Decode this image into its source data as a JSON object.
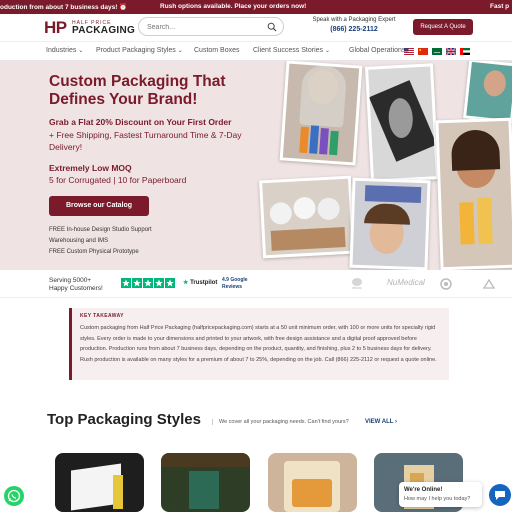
{
  "topbar": {
    "left_text": "oduction from about 7 business days! ⏰",
    "center_text": "Rush options available. Place your orders now!",
    "right_text": "Fast p"
  },
  "header": {
    "logo_mark": "HP",
    "logo_top": "HALF PRICE",
    "logo_bottom": "PACKAGING",
    "search_placeholder": "Search...",
    "expert_label": "Speak with a Packaging Expert",
    "expert_phone": "(866) 225-2112",
    "quote_button": "Request A Quote"
  },
  "nav": {
    "items": [
      {
        "label": "Industries",
        "has_chevron": true
      },
      {
        "label": "Product Packaging Styles",
        "has_chevron": true
      },
      {
        "label": "Custom Boxes",
        "has_chevron": false
      },
      {
        "label": "Client Success Stories",
        "has_chevron": true
      },
      {
        "label": "Global Operations:",
        "has_chevron": false
      }
    ],
    "chevron": "⌄"
  },
  "hero": {
    "title": "Custom Packaging That Defines Your Brand!",
    "offer": "Grab a Flat 20% Discount on Your First Order",
    "offer_details": "+ Free Shipping, Fastest Turnaround Time & 7-Day Delivery!",
    "moq_heading": "Extremely Low MOQ",
    "moq_details": "5 for Corrugated | 10 for Paperboard",
    "catalog_button": "Browse our Catalog",
    "features": [
      "FREE In-house Design Studio Support",
      "Warehousing and IMS",
      "FREE Custom Physical Prototype"
    ]
  },
  "trust": {
    "serving_line1": "Serving 5000+",
    "serving_line2": "Happy Customers!",
    "trustpilot": "Trustpilot",
    "rating_line1": "4.9 Google",
    "rating_line2": "Reviews",
    "star_color": "#00b67a",
    "clients": [
      "deuxo",
      "NuMedical"
    ]
  },
  "takeaway": {
    "heading": "KEY TAKEAWAY",
    "text": "Custom packaging from Half Price Packaging (halfpricepackaging.com) starts at a 50 unit minimum order, with 100 or more units for specialty rigid styles. Every order is made to your dimensions and printed to your artwork, with free design assistance and a digital proof approved before production. Production runs from about 7 business days, depending on the product, quantity, and finishing, plus 2 to 5 business days for delivery. Rush production is available on many styles for a premium of about 7 to 25%, depending on the job. Call (866) 225-2112 or request a quote online."
  },
  "styles_section": {
    "title": "Top Packaging Styles",
    "subtitle": "We cover all your packaging needs. Can't find yours?",
    "view_all": "VIEW ALL",
    "view_all_arrow": "›"
  },
  "chat": {
    "status": "We're Online!",
    "prompt": "How may I help you today?"
  },
  "colors": {
    "brand": "#7a1a2a",
    "hero_bg": "#efe3e3",
    "link": "#1a3e7a"
  }
}
